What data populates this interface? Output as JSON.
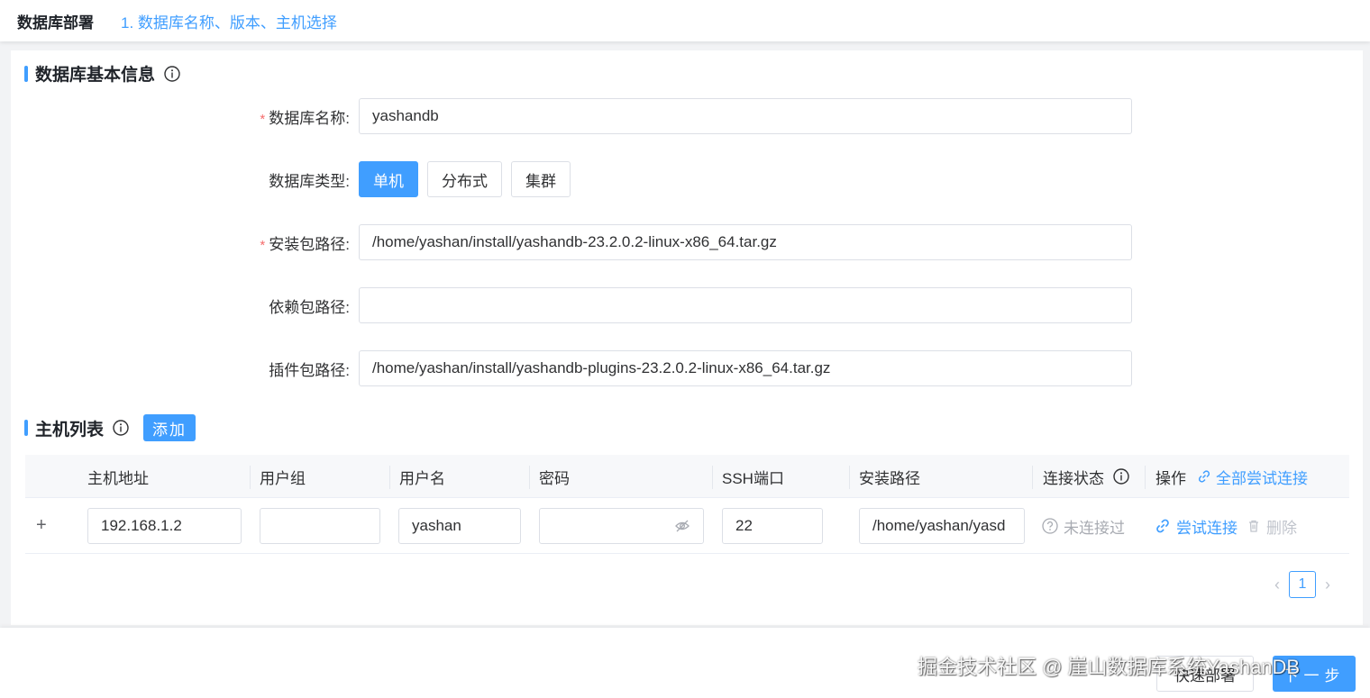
{
  "header": {
    "title": "数据库部署",
    "step": "1. 数据库名称、版本、主机选择"
  },
  "basic_info": {
    "section_title": "数据库基本信息",
    "db_name": {
      "label": "数据库名称:",
      "value": "yashandb",
      "required": true
    },
    "db_type": {
      "label": "数据库类型:",
      "options": [
        "单机",
        "分布式",
        "集群"
      ],
      "selected": "单机"
    },
    "install_pkg": {
      "label": "安装包路径:",
      "value": "/home/yashan/install/yashandb-23.2.0.2-linux-x86_64.tar.gz",
      "required": true
    },
    "dep_pkg": {
      "label": "依赖包路径:",
      "value": ""
    },
    "plugin_pkg": {
      "label": "插件包路径:",
      "value": "/home/yashan/install/yashandb-plugins-23.2.0.2-linux-x86_64.tar.gz"
    }
  },
  "host_list": {
    "section_title": "主机列表",
    "add_label": "添加",
    "columns": {
      "host": "主机地址",
      "group": "用户组",
      "user": "用户名",
      "password": "密码",
      "ssh_port": "SSH端口",
      "install_path": "安装路径",
      "status": "连接状态",
      "ops": "操作",
      "test_all": "全部尝试连接"
    },
    "rows": [
      {
        "expand": "+",
        "host": "192.168.1.2",
        "group": "",
        "user": "yashan",
        "password": "",
        "ssh_port": "22",
        "install_path": "/home/yashan/yasd",
        "status": "未连接过",
        "test_label": "尝试连接",
        "delete_label": "删除"
      }
    ]
  },
  "pagination": {
    "current": "1",
    "prev": "‹",
    "next": "›"
  },
  "footer": {
    "quick_deploy": "快速部署",
    "next": "下一步",
    "watermark": "掘金技术社区 @ 崖山数据库系统YashanDB"
  },
  "colors": {
    "primary": "#409eff",
    "required": "#f56c6c",
    "muted": "#a8abb2"
  }
}
